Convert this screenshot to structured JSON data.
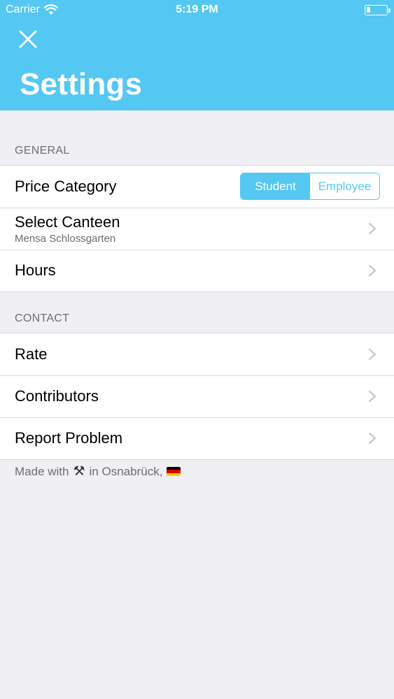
{
  "status_bar": {
    "carrier": "Carrier",
    "time": "5:19 PM"
  },
  "header": {
    "title": "Settings",
    "close_icon": "close-icon",
    "background_color": "#54c8f2"
  },
  "general": {
    "section_title": "GENERAL",
    "price_category": {
      "label": "Price Category",
      "options": [
        "Student",
        "Employee"
      ],
      "selected": "Student"
    },
    "select_canteen": {
      "label": "Select Canteen",
      "value": "Mensa Schlossgarten"
    },
    "hours": {
      "label": "Hours"
    }
  },
  "contact": {
    "section_title": "CONTACT",
    "items": [
      {
        "label": "Rate"
      },
      {
        "label": "Contributors"
      },
      {
        "label": "Report Problem"
      }
    ]
  },
  "footer": {
    "made_with": "Made with",
    "tools_emoji": "⚒",
    "in_city": "in Osnabrück,",
    "flag_icon": "germany-flag-icon"
  }
}
